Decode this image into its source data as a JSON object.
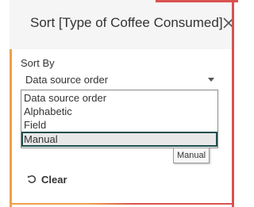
{
  "dialog": {
    "title": "Sort [Type of Coffee Consumed]",
    "close_icon": "close-icon"
  },
  "sort_by": {
    "label": "Sort By",
    "selected": "Data source order",
    "options": [
      "Data source order",
      "Alphabetic",
      "Field",
      "Manual"
    ],
    "highlighted_option": "Manual"
  },
  "tooltip": {
    "text": "Manual"
  },
  "clear": {
    "label": "Clear",
    "icon": "reset-icon"
  },
  "colors": {
    "accent_orange": "#f0a04b",
    "accent_red": "#d9534f",
    "highlight_border": "#1f4e4e"
  }
}
